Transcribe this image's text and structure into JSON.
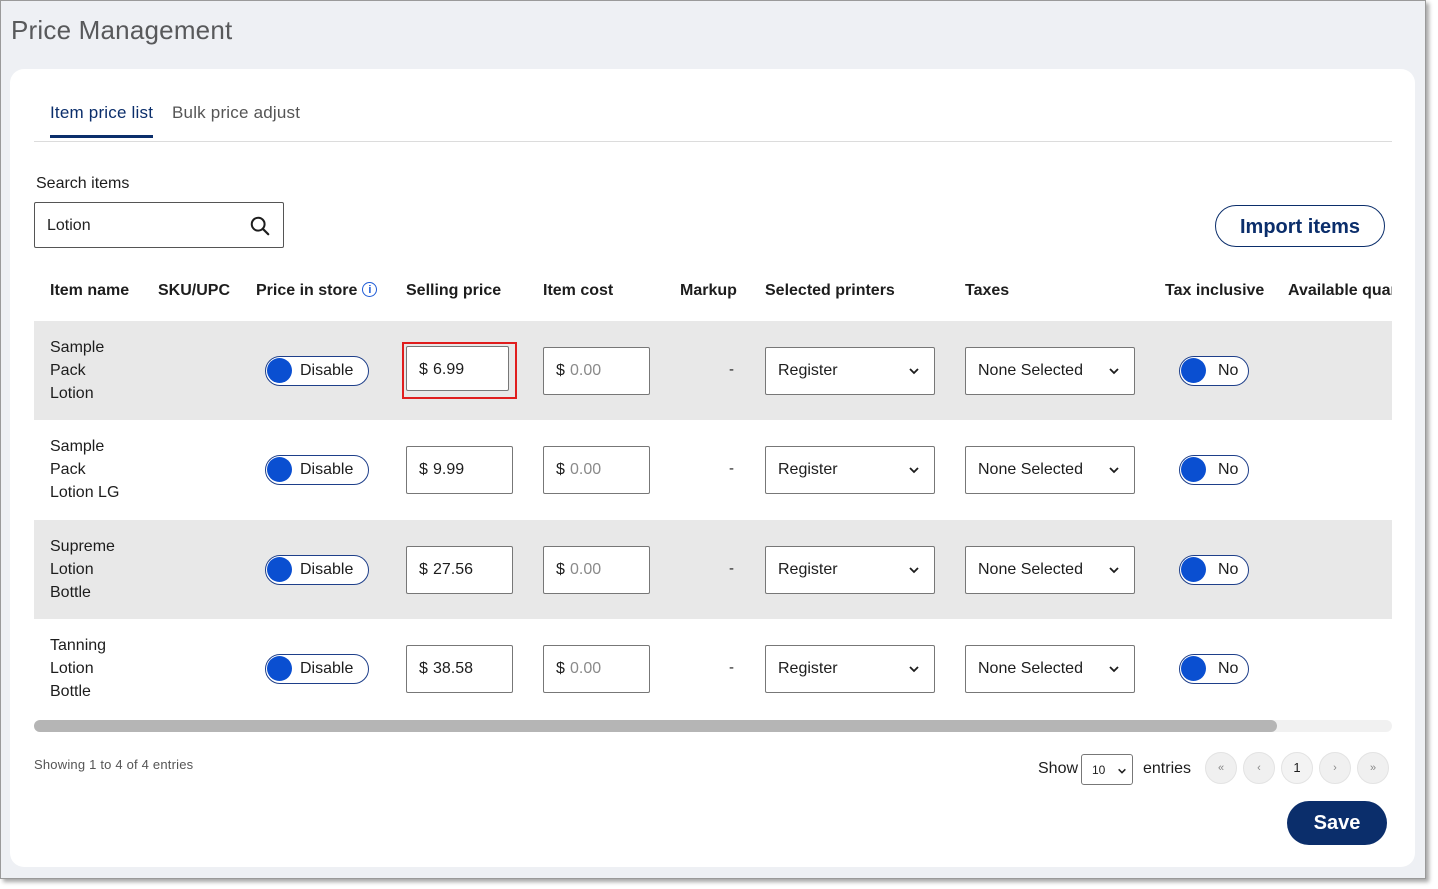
{
  "page": {
    "title": "Price Management"
  },
  "tabs": [
    {
      "label": "Item price list",
      "active": true
    },
    {
      "label": "Bulk price adjust",
      "active": false
    }
  ],
  "search": {
    "label": "Search items",
    "value": "Lotion"
  },
  "actions": {
    "import_label": "Import items",
    "save_label": "Save"
  },
  "table": {
    "columns": [
      "Item name",
      "SKU/UPC",
      "Price in store",
      "Selling price",
      "Item cost",
      "Markup",
      "Selected printers",
      "Taxes",
      "Tax inclusive",
      "Available quan"
    ],
    "rows": [
      {
        "name": [
          "Sample",
          "Pack",
          "Lotion"
        ],
        "sku": "",
        "price_in_store": "Disable",
        "currency": "$",
        "selling_price": "6.99",
        "item_cost": "0.00",
        "markup": "-",
        "printer": "Register",
        "taxes": "None Selected",
        "tax_inclusive": "No"
      },
      {
        "name": [
          "Sample",
          "Pack",
          "Lotion LG"
        ],
        "sku": "",
        "price_in_store": "Disable",
        "currency": "$",
        "selling_price": "9.99",
        "item_cost": "0.00",
        "markup": "-",
        "printer": "Register",
        "taxes": "None Selected",
        "tax_inclusive": "No"
      },
      {
        "name": [
          "Supreme",
          "Lotion",
          "Bottle"
        ],
        "sku": "",
        "price_in_store": "Disable",
        "currency": "$",
        "selling_price": "27.56",
        "item_cost": "0.00",
        "markup": "-",
        "printer": "Register",
        "taxes": "None Selected",
        "tax_inclusive": "No"
      },
      {
        "name": [
          "Tanning",
          "Lotion",
          "Bottle"
        ],
        "sku": "",
        "price_in_store": "Disable",
        "currency": "$",
        "selling_price": "38.58",
        "item_cost": "0.00",
        "markup": "-",
        "printer": "Register",
        "taxes": "None Selected",
        "tax_inclusive": "No"
      }
    ]
  },
  "footer": {
    "showing_text": "Showing 1 to 4 of 4 entries",
    "show_label": "Show",
    "entries_value": "10",
    "entries_label": "entries",
    "pagination": {
      "first": "«",
      "prev": "‹",
      "current": "1",
      "next": "›",
      "last": "»"
    }
  },
  "colors": {
    "brand": "#0b2e6b",
    "toggle_knob": "#0a4fd1",
    "highlight": "#e01e1e",
    "row_shade": "#e8e8e8"
  }
}
